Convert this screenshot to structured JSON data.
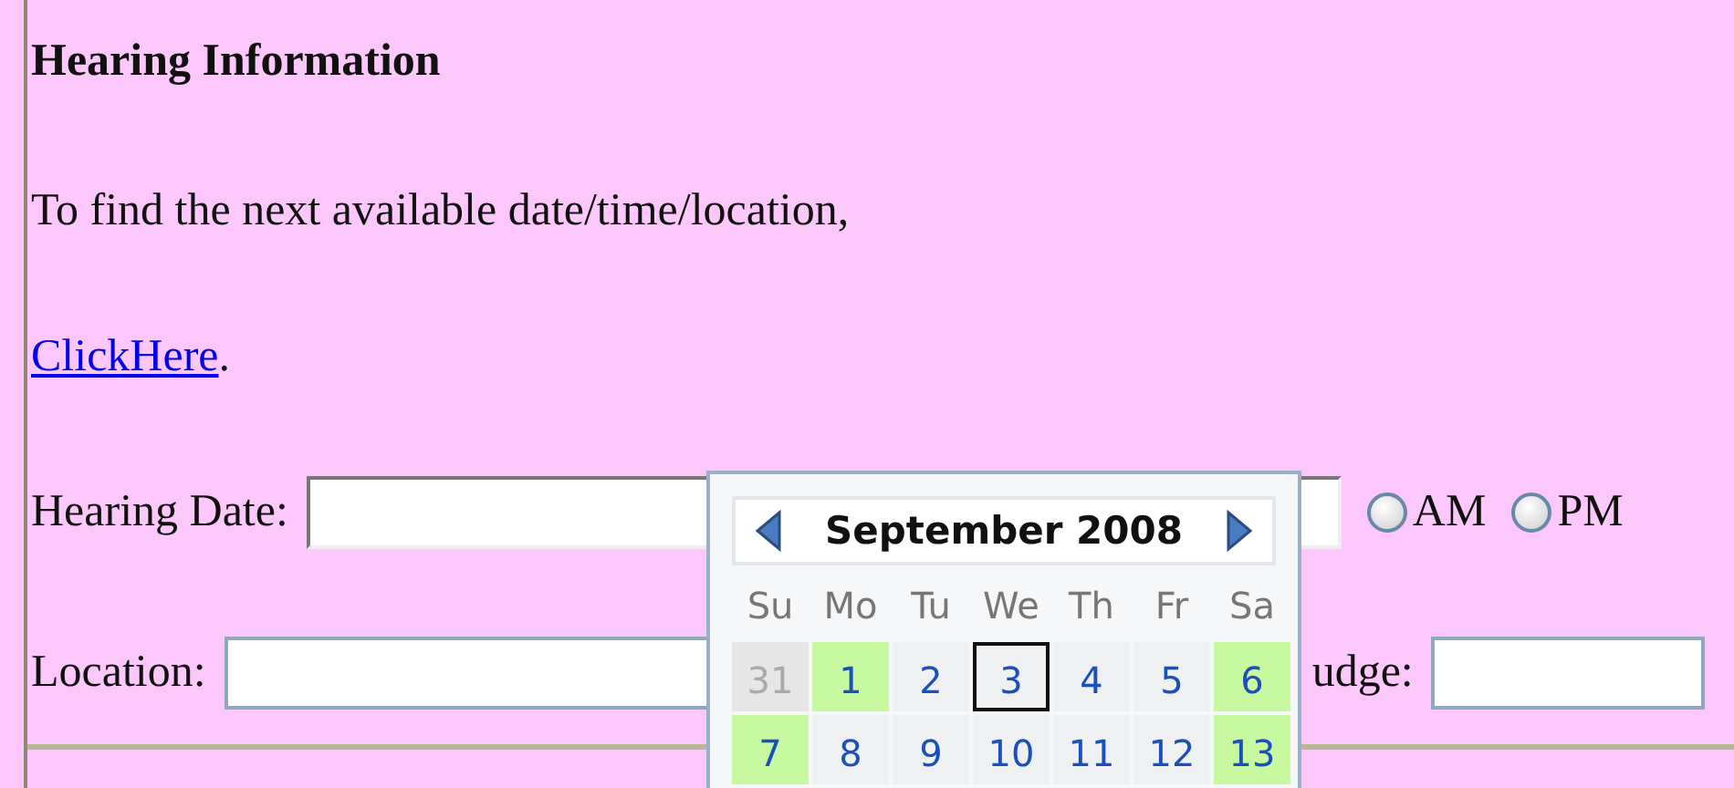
{
  "heading": "Hearing Information",
  "intro": "To find the next available date/time/location,",
  "link": {
    "label": "ClickHere",
    "after": "."
  },
  "hearing_date": {
    "label": "Hearing Date:",
    "ampm": [
      {
        "label": "AM",
        "selected": false
      },
      {
        "label": "PM",
        "selected": false
      }
    ]
  },
  "location": {
    "label": "Location:"
  },
  "judge": {
    "label": "udge:"
  },
  "calendar": {
    "title": "September 2008",
    "weekdays": [
      "Su",
      "Mo",
      "Tu",
      "We",
      "Th",
      "Fr",
      "Sa"
    ],
    "days": [
      {
        "label": "31",
        "kind": "outside",
        "selected": false
      },
      {
        "label": "1",
        "kind": "weekend",
        "selected": false
      },
      {
        "label": "2",
        "kind": "weekday",
        "selected": false
      },
      {
        "label": "3",
        "kind": "weekday",
        "selected": true
      },
      {
        "label": "4",
        "kind": "weekday",
        "selected": false
      },
      {
        "label": "5",
        "kind": "weekday",
        "selected": false
      },
      {
        "label": "6",
        "kind": "weekend",
        "selected": false
      },
      {
        "label": "7",
        "kind": "weekend",
        "selected": false
      },
      {
        "label": "8",
        "kind": "weekday",
        "selected": false
      },
      {
        "label": "9",
        "kind": "weekday",
        "selected": false
      },
      {
        "label": "10",
        "kind": "weekday",
        "selected": false
      },
      {
        "label": "11",
        "kind": "weekday",
        "selected": false
      },
      {
        "label": "12",
        "kind": "weekday",
        "selected": false
      },
      {
        "label": "13",
        "kind": "weekend",
        "selected": false
      }
    ]
  }
}
